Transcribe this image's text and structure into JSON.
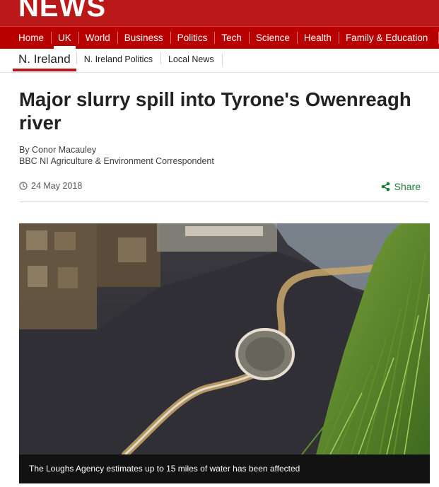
{
  "brand": {
    "logo_text": "NEWS"
  },
  "nav": {
    "items": [
      {
        "label": "Home"
      },
      {
        "label": "UK"
      },
      {
        "label": "World"
      },
      {
        "label": "Business"
      },
      {
        "label": "Politics"
      },
      {
        "label": "Tech"
      },
      {
        "label": "Science"
      },
      {
        "label": "Health"
      },
      {
        "label": "Family & Education"
      }
    ],
    "active": "UK"
  },
  "subnav": {
    "primary": "N. Ireland",
    "items": [
      {
        "label": "N. Ireland Politics"
      },
      {
        "label": "Local News"
      }
    ]
  },
  "article": {
    "headline": "Major slurry spill into Tyrone's Owenreagh river",
    "byline_author": "By Conor Macauley",
    "byline_role": "BBC NI Agriculture & Environment Correspondent",
    "date": "24 May 2018",
    "share_label": "Share",
    "image_caption": "The Loughs Agency estimates up to 15 miles of water has been affected"
  },
  "icons": {
    "clock": "clock-icon",
    "share": "share-icon"
  },
  "colors": {
    "brand_red": "#bb1919",
    "nav_red": "#b80000",
    "share_green": "#1f7a3a"
  }
}
